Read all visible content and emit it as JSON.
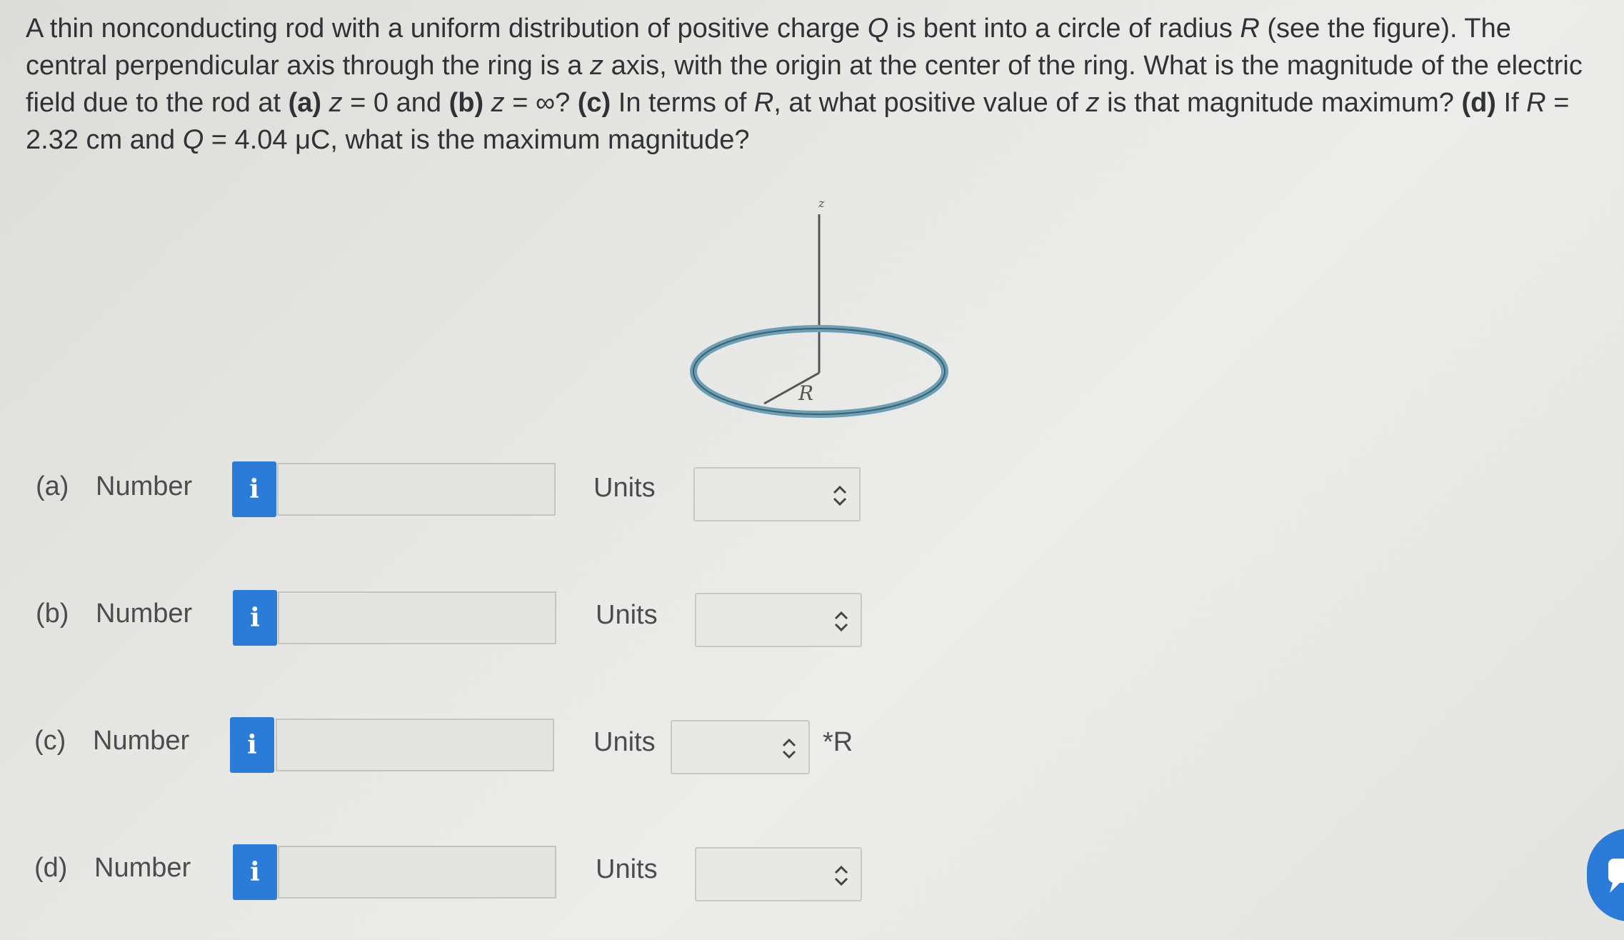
{
  "problem": {
    "intro": "A thin nonconducting rod with a uniform distribution of positive charge ",
    "q": "Q",
    "mid1": " is bent into a circle of radius ",
    "r": "R",
    "mid2": " (see the figure). The central perpendicular axis through the ring is a ",
    "z1": "z",
    "mid3": " axis, with the origin at the center of the ring. What is the magnitude of the electric field due to the rod at ",
    "a_label": "(a)",
    "a_eq_var": " z",
    "a_eq": " = 0 and ",
    "b_label": "(b)",
    "b_eq_var": " z",
    "b_eq": " = ∞? ",
    "c_label": "(c)",
    "c_text1": " In terms of ",
    "c_r": "R",
    "c_text2": ", at what positive value of ",
    "c_z": "z",
    "c_text3": " is that magnitude maximum? ",
    "d_label": "(d)",
    "d_text1": " If ",
    "d_r": "R",
    "d_text2": " = 2.32 cm and ",
    "d_q": "Q",
    "d_text3": " = 4.04 μC, what is the maximum magnitude?"
  },
  "figure": {
    "axis_label": "z",
    "radius_label": "R",
    "ring_color": "#6a9fb5"
  },
  "parts": [
    {
      "label": "(a)",
      "number_label": "Number",
      "info_icon": "i",
      "units_label": "Units",
      "units_value": "",
      "suffix": ""
    },
    {
      "label": "(b)",
      "number_label": "Number",
      "info_icon": "i",
      "units_label": "Units",
      "units_value": "",
      "suffix": ""
    },
    {
      "label": "(c)",
      "number_label": "Number",
      "info_icon": "i",
      "units_label": "Units",
      "units_value": "",
      "suffix": "*R"
    },
    {
      "label": "(d)",
      "number_label": "Number",
      "info_icon": "i",
      "units_label": "Units",
      "units_value": "",
      "suffix": ""
    }
  ],
  "colors": {
    "accent": "#2b7bd8",
    "text": "#2f3236"
  }
}
